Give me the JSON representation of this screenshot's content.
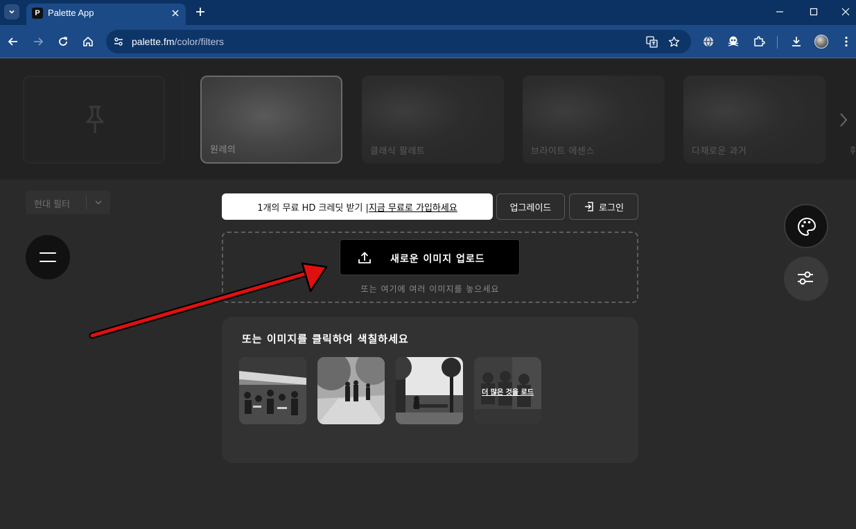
{
  "browser": {
    "tab_title": "Palette App",
    "favicon_letter": "P",
    "url_host": "palette.fm",
    "url_path": "/color/filters"
  },
  "filters": {
    "cards": [
      {
        "label": ""
      },
      {
        "label": "원레의"
      },
      {
        "label": "클래식 팔레트"
      },
      {
        "label": "브라이트 에센스"
      },
      {
        "label": "다채로운 과거"
      }
    ],
    "cut_label": "휘"
  },
  "mode_select": {
    "label": "현대 필터"
  },
  "notice": {
    "text": "1개의 무료 HD 크레딧 받기 | ",
    "link": "지금 무료로 가입하세요"
  },
  "buttons": {
    "upgrade": "업그레이드",
    "login": "로그인"
  },
  "upload": {
    "button_label": "새로운 이미지 업로드",
    "hint": "또는 여기에 여러 이미지를 놓으세요"
  },
  "samples": {
    "title": "또는 이미지를 클릭하여 색칠하세요",
    "more_label": "더 많은 것을 로드"
  },
  "colors": {
    "annotation_arrow": "#e01010",
    "page_background": "#2a2a2b",
    "browser_chrome": "#1b4a86"
  }
}
